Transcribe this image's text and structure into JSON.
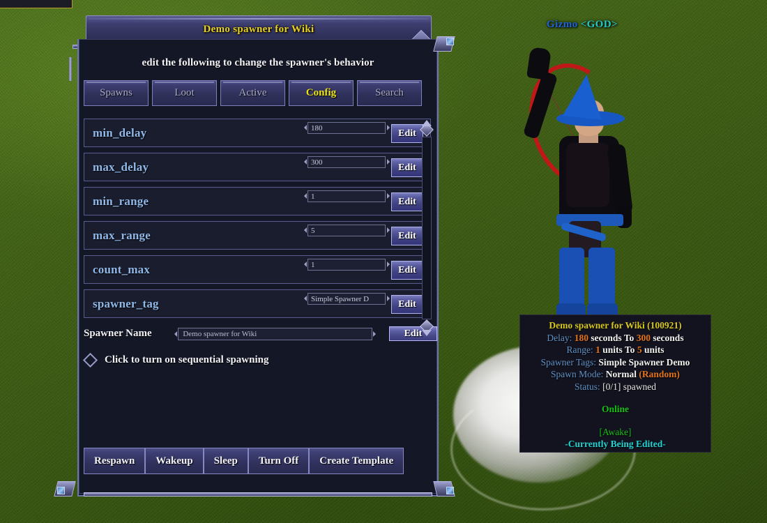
{
  "player": {
    "name": "Gizmo",
    "rank": "<GOD>"
  },
  "window": {
    "title": "Demo spawner for Wiki",
    "close_icon": "close-x-icon",
    "subtitle": "edit the following to change the spawner's behavior",
    "gem_icon": "green-gem-icon"
  },
  "tabs": [
    {
      "label": "Spawns",
      "active": false
    },
    {
      "label": "Loot",
      "active": false
    },
    {
      "label": "Active",
      "active": false
    },
    {
      "label": "Config",
      "active": true
    },
    {
      "label": "Search",
      "active": false
    }
  ],
  "properties": [
    {
      "name": "min_delay",
      "value": "180",
      "edit_label": "Edit"
    },
    {
      "name": "max_delay",
      "value": "300",
      "edit_label": "Edit"
    },
    {
      "name": "min_range",
      "value": "1",
      "edit_label": "Edit"
    },
    {
      "name": "max_range",
      "value": "5",
      "edit_label": "Edit"
    },
    {
      "name": "count_max",
      "value": "1",
      "edit_label": "Edit"
    },
    {
      "name": "spawner_tag",
      "value": "Simple Spawner D",
      "edit_label": "Edit"
    }
  ],
  "spawner_name": {
    "label": "Spawner Name",
    "value": "Demo spawner for Wiki",
    "edit_label": "Edit"
  },
  "sequential": {
    "label": "Click to turn on sequential spawning",
    "checked": false
  },
  "actions": [
    {
      "label": "Respawn"
    },
    {
      "label": "Wakeup"
    },
    {
      "label": "Sleep"
    },
    {
      "label": "Turn Off"
    },
    {
      "label": "Create Template"
    }
  ],
  "scrollbar": {
    "up_icon": "scroll-up-diamond-icon",
    "down_icon": "scroll-down-diamond-icon"
  },
  "tooltip": {
    "title": "Demo spawner for Wiki (100921)",
    "delay_label": "Delay:",
    "delay_min": "180",
    "delay_unit1": "seconds To",
    "delay_max": "300",
    "delay_unit2": "seconds",
    "range_label": "Range:",
    "range_min": "1",
    "range_unit1": "units To",
    "range_max": "5",
    "range_unit2": "units",
    "tags_label": "Spawner Tags:",
    "tags_value": "Simple Spawner Demo",
    "mode_label": "Spawn Mode:",
    "mode_value": "Normal",
    "mode_extra": "(Random)",
    "status_label": "Status:",
    "status_value": "[0/1] spawned",
    "online": "Online",
    "awake": "[Awake]",
    "editing": "-Currently Being Edited-"
  },
  "colors": {
    "accent_yellow": "#e8d21c",
    "prop_name_blue": "#8fb8e8",
    "tooltip_label": "#5f93c8",
    "tooltip_number": "#e4741c",
    "online_green": "#15c215",
    "editing_cyan": "#1fd4d4"
  }
}
